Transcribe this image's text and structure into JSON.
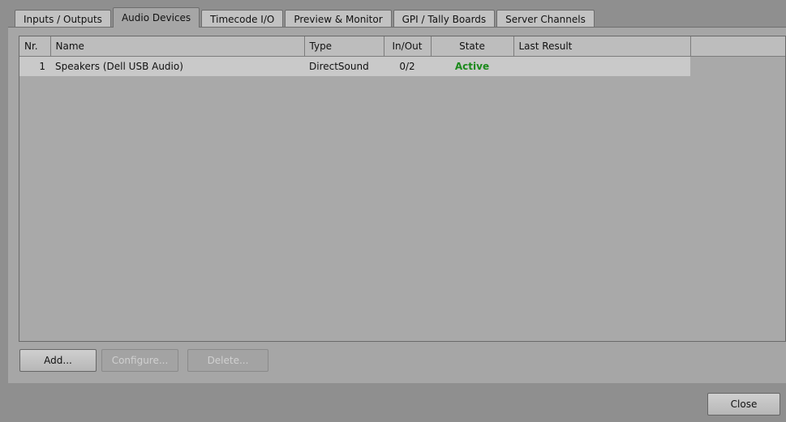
{
  "tabs": [
    {
      "label": "Inputs / Outputs",
      "active": false
    },
    {
      "label": "Audio Devices",
      "active": true
    },
    {
      "label": "Timecode I/O",
      "active": false
    },
    {
      "label": "Preview & Monitor",
      "active": false
    },
    {
      "label": "GPI / Tally Boards",
      "active": false
    },
    {
      "label": "Server Channels",
      "active": false
    }
  ],
  "table": {
    "columns": [
      "Nr.",
      "Name",
      "Type",
      "In/Out",
      "State",
      "Last Result"
    ],
    "rows": [
      {
        "nr": "1",
        "name": "Speakers (Dell USB Audio)",
        "type": "DirectSound",
        "inout": "0/2",
        "state": "Active",
        "last_result": ""
      }
    ]
  },
  "buttons": {
    "add": "Add...",
    "configure": "Configure...",
    "delete": "Delete...",
    "close": "Close"
  },
  "colors": {
    "state_active": "#1b8a1b"
  }
}
